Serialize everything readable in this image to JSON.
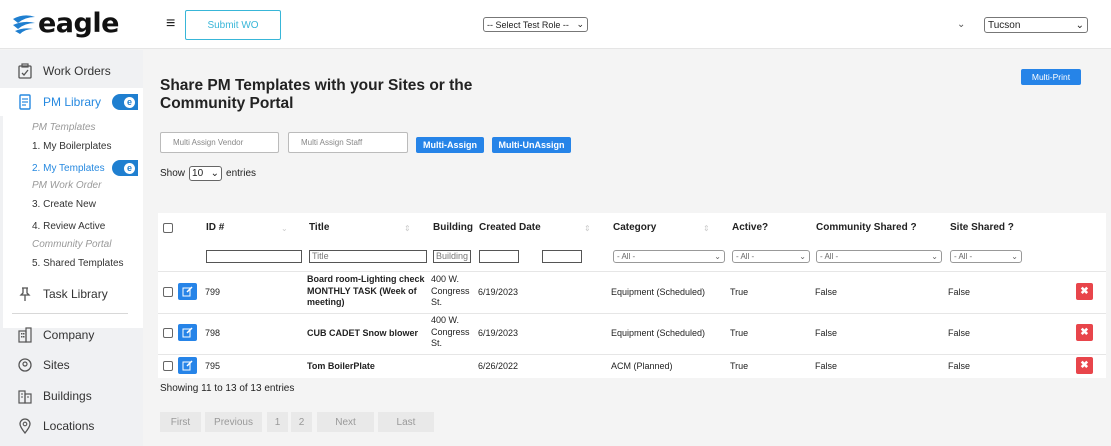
{
  "header": {
    "logo_text": "eagle",
    "submit_label": "Submit WO",
    "role_select": "-- Select Test Role --",
    "site_select": "Tucson"
  },
  "sidebar": {
    "items": [
      {
        "label": "Work Orders",
        "icon": "clipboard-icon"
      },
      {
        "label": "PM Library",
        "icon": "document-icon"
      },
      {
        "label": "Task Library",
        "icon": "pin-icon"
      },
      {
        "label": "Company",
        "icon": "building-icon"
      },
      {
        "label": "Sites",
        "icon": "location-icon"
      },
      {
        "label": "Buildings",
        "icon": "buildings-icon"
      },
      {
        "label": "Locations",
        "icon": "map-pin-icon"
      }
    ],
    "submenu": [
      {
        "label": "PM Templates"
      },
      {
        "label": "1. My Boilerplates"
      },
      {
        "label": "2. My Templates"
      },
      {
        "label": "PM Work Order"
      },
      {
        "label": "3. Create New"
      },
      {
        "label": "4. Review Active"
      },
      {
        "label": "Community Portal"
      },
      {
        "label": "5. Shared Templates"
      }
    ],
    "badge_letter": "e"
  },
  "main": {
    "title": "Share PM Templates with your Sites or the Community Portal",
    "multi_print": "Multi-Print",
    "assign_vendor_placeholder": "Multi Assign Vendor",
    "assign_staff_placeholder": "Multi Assign Staff",
    "multi_assign": "Multi-Assign",
    "multi_unassign": "Multi-UnAssign",
    "show_label": "Show",
    "entries_label": "entries",
    "page_length": "10",
    "showing_text": "Showing 11 to 13 of 13 entries"
  },
  "table": {
    "headers": [
      "ID #",
      "Title",
      "Building",
      "Created Date",
      "Category",
      "Active?",
      "Community Shared ?",
      "Site Shared ?"
    ],
    "filters": {
      "title_placeholder": "Title",
      "building_placeholder": "Building",
      "all_label": "- All -"
    },
    "rows": [
      {
        "id": "799",
        "title": "Board room-Lighting check MONTHLY TASK (Week of meeting)",
        "building": "400 W. Congress St.",
        "created": "6/19/2023",
        "category": "Equipment (Scheduled)",
        "active": "True",
        "community": "False",
        "site": "False"
      },
      {
        "id": "798",
        "title": "CUB CADET Snow blower",
        "building": "400 W. Congress St.",
        "created": "6/19/2023",
        "category": "Equipment (Scheduled)",
        "active": "True",
        "community": "False",
        "site": "False"
      },
      {
        "id": "795",
        "title": "Tom BoilerPlate",
        "building": "",
        "created": "6/26/2022",
        "category": "ACM (Planned)",
        "active": "True",
        "community": "False",
        "site": "False"
      }
    ]
  },
  "pagination": {
    "first": "First",
    "previous": "Previous",
    "page1": "1",
    "page2": "2",
    "next": "Next",
    "last": "Last"
  },
  "colors": {
    "accent": "#2684e8",
    "danger": "#e8454b",
    "submit_outline": "#38b6d8"
  }
}
